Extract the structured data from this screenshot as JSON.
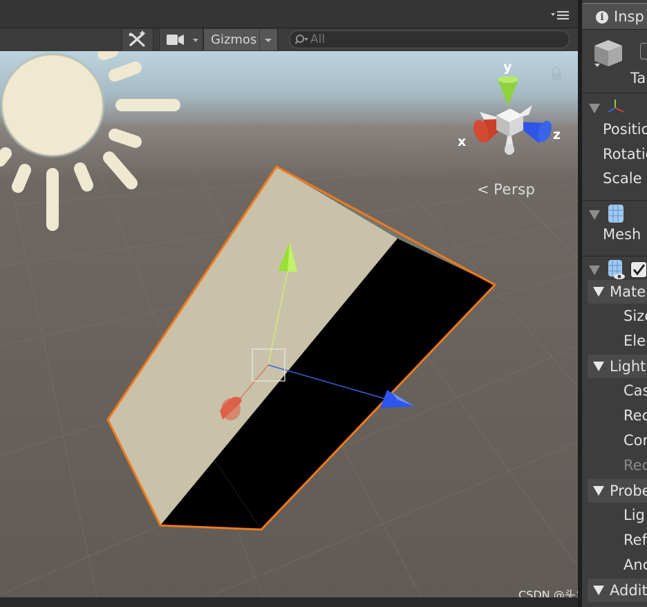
{
  "toolbar": {
    "gizmos_label": "Gizmos",
    "search_placeholder": "All",
    "icons": [
      "effects-icon",
      "camera-icon",
      "dropdown-arrow-icon",
      "search-icon",
      "panel-menu-icon"
    ]
  },
  "scene": {
    "view_mode_label": "Persp",
    "axes": {
      "x": "x",
      "y": "y",
      "z": "z"
    },
    "colors": {
      "sky": "#a9c4d2",
      "ground": "#6b6560",
      "selection_outline": "#f07a1a",
      "lit_face": "#c9c2aa",
      "unlit_face": "#000000",
      "axis_x": "#d8432c",
      "axis_y": "#8fd23c",
      "axis_z": "#3a64e8",
      "sun": "#efe9d2"
    }
  },
  "inspector": {
    "tab_label": "Insp",
    "object_tag_label": "Ta",
    "transform": {
      "labels": [
        "Positio",
        "Rotatio",
        "Scale"
      ]
    },
    "mesh_filter": {
      "label": "Mesh"
    },
    "mesh_renderer": {
      "materials_label": "Mater",
      "materials_items": [
        "Size",
        "Eler"
      ],
      "lighting_label": "Light",
      "lighting_items": [
        "Cas",
        "Rec",
        "Cor"
      ],
      "lighting_disabled_item": "Rec",
      "probes_label": "Probe",
      "probes_items": [
        "Lig",
        "Ref",
        "Anc"
      ],
      "additional_label": "Addit"
    }
  },
  "watermark": "CSDN @头发要茂密"
}
